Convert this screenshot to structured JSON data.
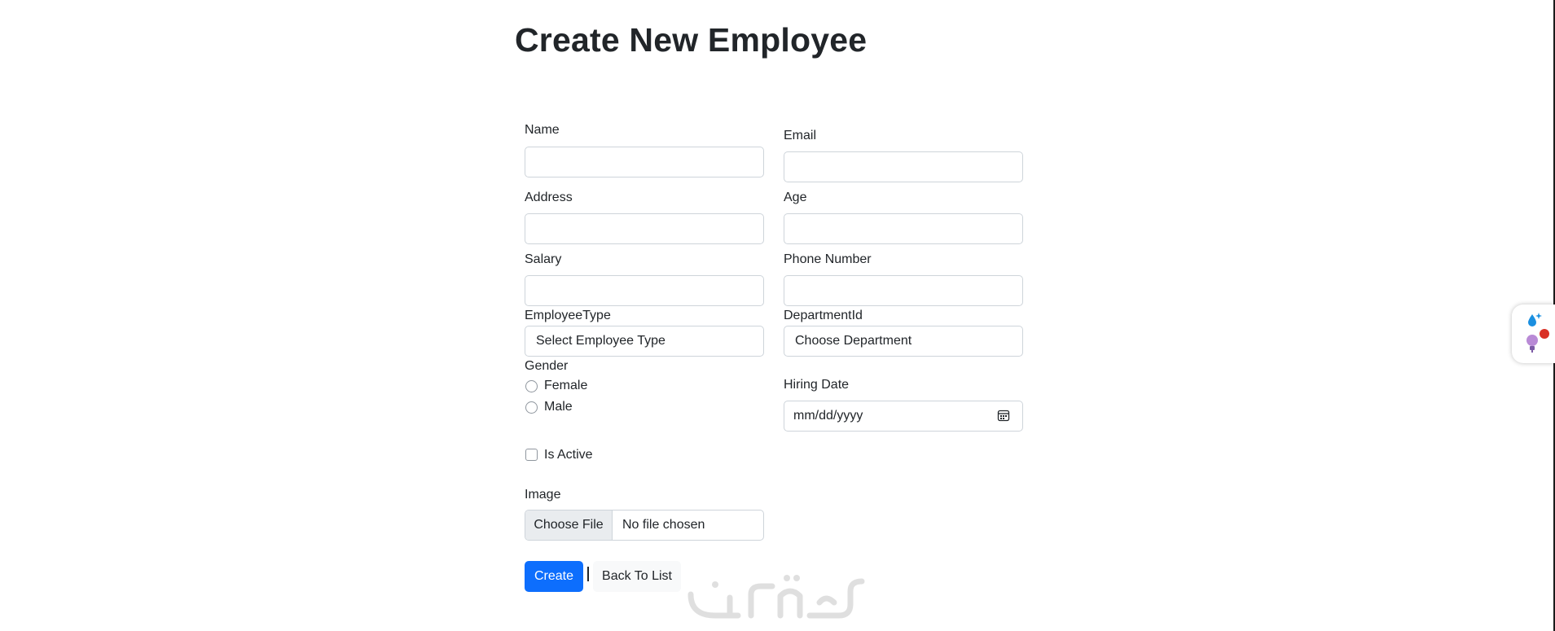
{
  "page": {
    "title": "Create New Employee"
  },
  "form": {
    "name": {
      "label": "Name",
      "value": ""
    },
    "email": {
      "label": "Email",
      "value": ""
    },
    "address": {
      "label": "Address",
      "value": ""
    },
    "age": {
      "label": "Age",
      "value": ""
    },
    "salary": {
      "label": "Salary",
      "value": ""
    },
    "phone": {
      "label": "Phone Number",
      "value": ""
    },
    "employee_type": {
      "label": "EmployeeType",
      "selected": "Select Employee Type"
    },
    "department": {
      "label": "DepartmentId",
      "selected": "Choose Department"
    },
    "gender": {
      "label": "Gender",
      "options": [
        {
          "label": "Female",
          "checked": false
        },
        {
          "label": "Male",
          "checked": false
        }
      ]
    },
    "hiring_date": {
      "label": "Hiring Date",
      "placeholder": "mm/dd/yyyy",
      "icon": "calendar-icon"
    },
    "is_active": {
      "label": "Is Active",
      "checked": false
    },
    "image": {
      "label": "Image",
      "button_label": "Choose File",
      "status": "No file chosen"
    }
  },
  "actions": {
    "create_label": "Create",
    "separator": "|",
    "back_label": "Back To List"
  },
  "colors": {
    "primary": "#0d6efd",
    "border": "#ced4da",
    "text": "#212529",
    "light_button": "#f8f9fa",
    "file_button": "#e9ecef"
  },
  "extensions": [
    {
      "icon": "water-drop-sparkle-icon"
    },
    {
      "icon": "lightbulb-extension-icon",
      "badge_color": "#d93025"
    }
  ],
  "watermark": {
    "icon": "arabic-logo-watermark"
  }
}
